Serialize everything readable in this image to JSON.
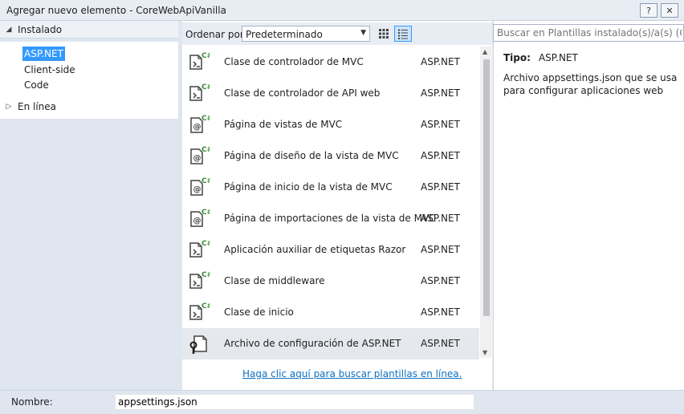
{
  "window": {
    "title": "Agregar nuevo elemento - CoreWebApiVanilla",
    "help_label": "?",
    "close_label": "✕"
  },
  "sidebar": {
    "installed_label": "Instalado",
    "items": [
      {
        "label": "ASP.NET",
        "selected": true
      },
      {
        "label": "Client-side",
        "selected": false
      },
      {
        "label": "Code",
        "selected": false
      }
    ],
    "online_label": "En línea"
  },
  "toolbar": {
    "sort_label": "Ordenar por:",
    "sort_value": "Predeterminado",
    "view_modes": [
      "grid-view-icon",
      "list-view-icon"
    ],
    "active_view": "list"
  },
  "search": {
    "placeholder": "Buscar en Plantillas instalado(s)/a(s) (C"
  },
  "templates": [
    {
      "name": "Clase de controlador de MVC",
      "category": "ASP.NET",
      "icon": "csharp-class-icon"
    },
    {
      "name": "Clase de controlador de API web",
      "category": "ASP.NET",
      "icon": "csharp-class-icon"
    },
    {
      "name": "Página de vistas de MVC",
      "category": "ASP.NET",
      "icon": "razor-page-icon"
    },
    {
      "name": "Página de diseño de la vista de MVC",
      "category": "ASP.NET",
      "icon": "razor-page-icon"
    },
    {
      "name": "Página de inicio de la vista de MVC",
      "category": "ASP.NET",
      "icon": "razor-page-icon"
    },
    {
      "name": "Página de importaciones de la vista de MVC",
      "category": "ASP.NET",
      "icon": "razor-page-icon"
    },
    {
      "name": "Aplicación auxiliar de etiquetas Razor",
      "category": "ASP.NET",
      "icon": "csharp-class-icon"
    },
    {
      "name": "Clase de middleware",
      "category": "ASP.NET",
      "icon": "csharp-class-icon"
    },
    {
      "name": "Clase de inicio",
      "category": "ASP.NET",
      "icon": "csharp-class-icon"
    },
    {
      "name": "Archivo de configuración de ASP.NET",
      "category": "ASP.NET",
      "icon": "config-file-icon",
      "selected": true
    }
  ],
  "online_link": "Haga clic aquí para buscar plantillas en línea.",
  "details": {
    "type_label": "Tipo:",
    "type_value": "ASP.NET",
    "description": "Archivo appsettings.json que se usa para configurar aplicaciones web"
  },
  "footer": {
    "name_label": "Nombre:",
    "name_value": "appsettings.json"
  },
  "colors": {
    "selection": "#3399ff",
    "csharp_badge": "#388a34",
    "link": "#0e70c0"
  }
}
